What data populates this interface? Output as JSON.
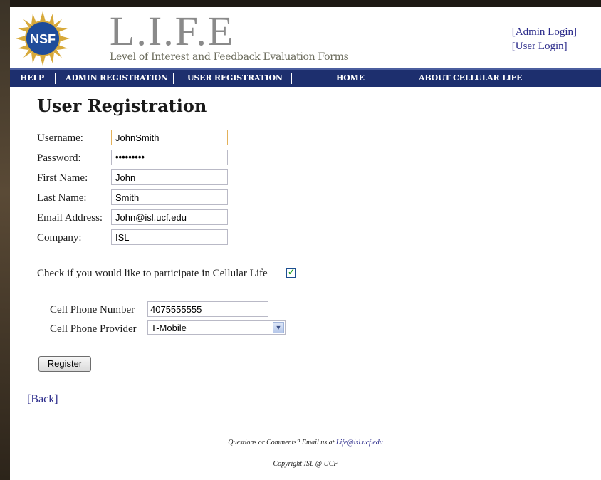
{
  "header": {
    "title": "L.I.F.E",
    "subtitle": "Level of Interest and Feedback Evaluation Forms",
    "logo_text": "NSF",
    "admin_login": "[Admin Login]",
    "user_login": "[User Login]"
  },
  "nav": {
    "items": [
      "HELP",
      "ADMIN REGISTRATION",
      "USER REGISTRATION",
      "HOME",
      "ABOUT CELLULAR LIFE"
    ]
  },
  "main": {
    "title": "User Registration",
    "fields": [
      {
        "label": "Username:",
        "value": "JohnSmith"
      },
      {
        "label": "Password:",
        "value": "•••••••••"
      },
      {
        "label": "First Name:",
        "value": "John"
      },
      {
        "label": "Last Name:",
        "value": "Smith"
      },
      {
        "label": "Email Address:",
        "value": "John@isl.ucf.edu"
      },
      {
        "label": "Company:",
        "value": "ISL"
      }
    ],
    "participate_label": "Check if you would like to participate in Cellular Life",
    "participate_checked": true,
    "cell_phone_number_label": "Cell Phone Number",
    "cell_phone_number_value": "4075555555",
    "cell_phone_provider_label": "Cell Phone Provider",
    "cell_phone_provider_value": "T-Mobile",
    "register_label": "Register",
    "back_label": "[Back]"
  },
  "footer": {
    "questions_text": "Questions or Comments? Email us at",
    "email": "Life@isl.ucf.edu",
    "copyright": "Copyright ISL @ UCF"
  },
  "colors": {
    "nav_bg": "#1d2f6e",
    "link": "#2a2a8a",
    "focus_border": "#e3b15a",
    "check": "#21a121"
  },
  "icons": {
    "logo": "nsf-logo",
    "dropdown": "chevron-down-icon",
    "check": "checkmark-icon"
  }
}
